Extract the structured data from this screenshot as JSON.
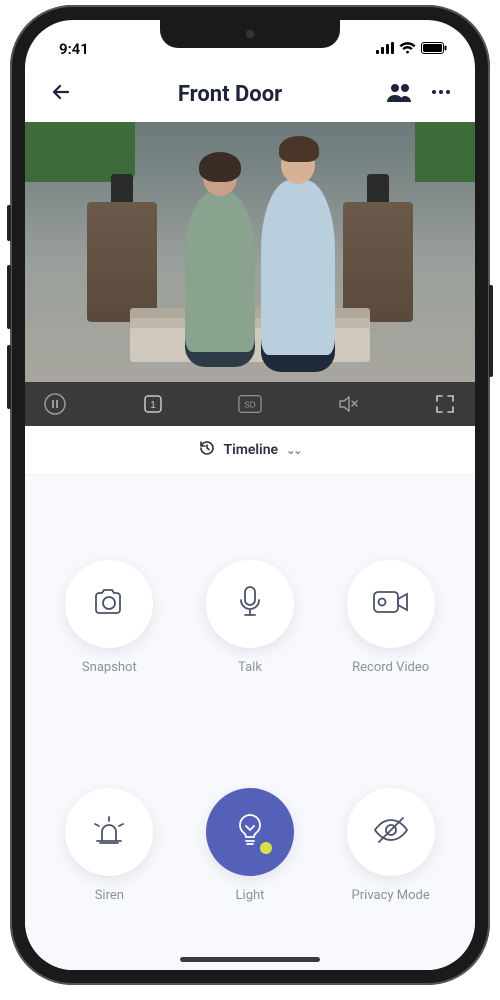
{
  "status": {
    "time": "9:41"
  },
  "header": {
    "title": "Front Door"
  },
  "video_controls": {
    "pause": "pause",
    "channel": "1",
    "quality": "SD",
    "mute": "muted",
    "fullscreen": "fullscreen"
  },
  "timeline": {
    "label": "Timeline"
  },
  "actions": {
    "snapshot": {
      "label": "Snapshot"
    },
    "talk": {
      "label": "Talk"
    },
    "record": {
      "label": "Record Video"
    },
    "siren": {
      "label": "Siren"
    },
    "light": {
      "label": "Light",
      "active": true
    },
    "privacy": {
      "label": "Privacy Mode"
    }
  }
}
